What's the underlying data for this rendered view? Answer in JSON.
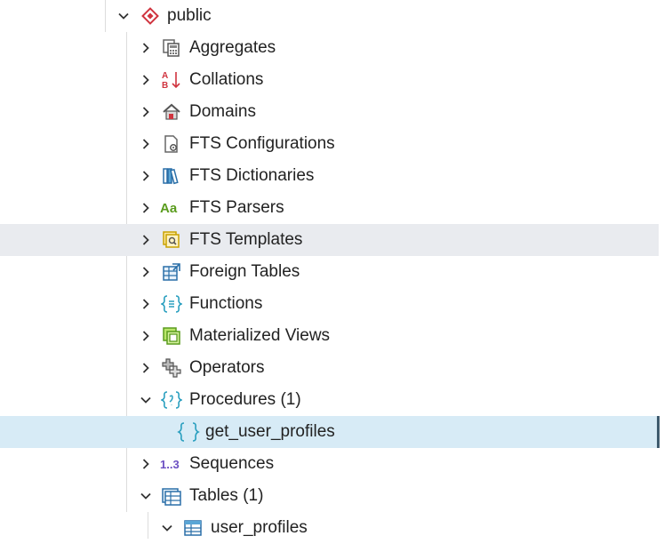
{
  "tree": {
    "schema": {
      "label": "public",
      "icon": "schema-icon",
      "expanded": true
    },
    "items": [
      {
        "label": "Aggregates",
        "icon": "aggregates-icon",
        "expanded": false
      },
      {
        "label": "Collations",
        "icon": "collations-icon",
        "expanded": false
      },
      {
        "label": "Domains",
        "icon": "domains-icon",
        "expanded": false
      },
      {
        "label": "FTS Configurations",
        "icon": "fts-configurations-icon",
        "expanded": false
      },
      {
        "label": "FTS Dictionaries",
        "icon": "fts-dictionaries-icon",
        "expanded": false
      },
      {
        "label": "FTS Parsers",
        "icon": "fts-parsers-icon",
        "icon_text": "Aa",
        "expanded": false
      },
      {
        "label": "FTS Templates",
        "icon": "fts-templates-icon",
        "expanded": false,
        "hovered": true
      },
      {
        "label": "Foreign Tables",
        "icon": "foreign-tables-icon",
        "expanded": false
      },
      {
        "label": "Functions",
        "icon": "functions-icon",
        "expanded": false
      },
      {
        "label": "Materialized Views",
        "icon": "materialized-views-icon",
        "expanded": false
      },
      {
        "label": "Operators",
        "icon": "operators-icon",
        "expanded": false
      },
      {
        "label": "Procedures (1)",
        "icon": "procedures-icon",
        "expanded": true,
        "children": [
          {
            "label": "get_user_profiles",
            "icon": "procedure-icon",
            "selected": true
          }
        ]
      },
      {
        "label": "Sequences",
        "icon": "sequences-icon",
        "icon_text": "1..3",
        "expanded": false
      },
      {
        "label": "Tables (1)",
        "icon": "tables-icon",
        "expanded": true,
        "children": [
          {
            "label": "user_profiles",
            "icon": "table-icon",
            "expanded": true
          }
        ]
      }
    ]
  },
  "colors": {
    "hover_row": "#e9ebef",
    "selected_row": "#d7ebf6",
    "selected_marker": "#3f5b6e",
    "schema_red": "#d0343f",
    "fts_parsers_green": "#5a9c1e",
    "sequences_purple": "#6b4fc2",
    "functions_teal": "#2a9fbf"
  }
}
